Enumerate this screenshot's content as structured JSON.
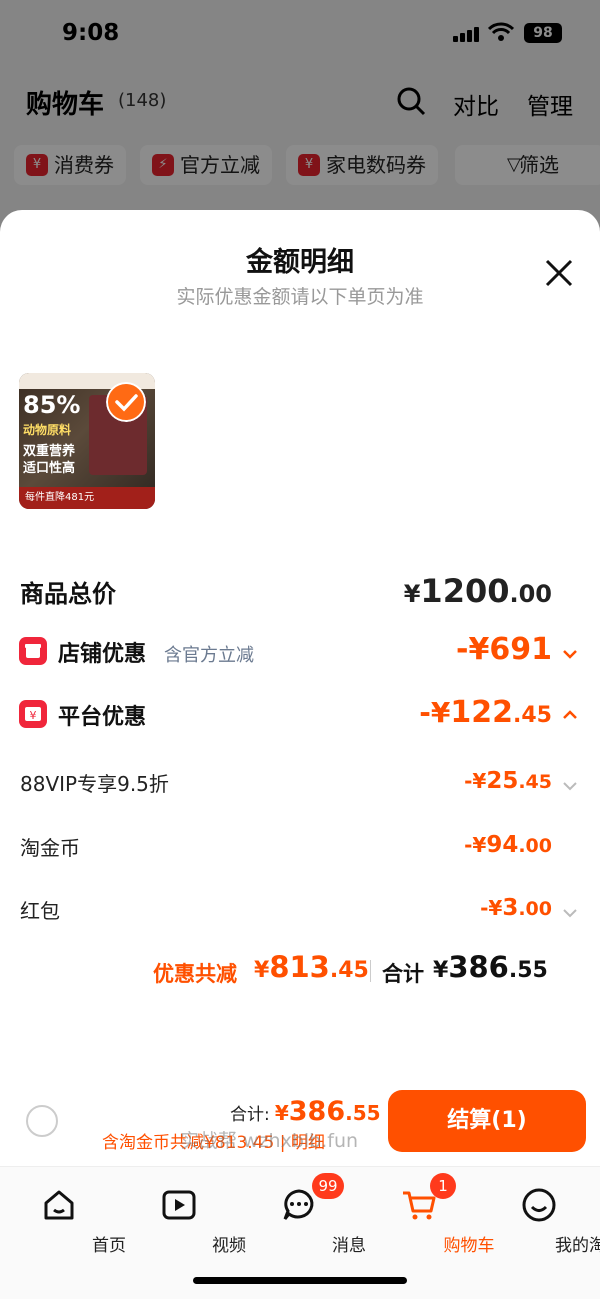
{
  "status": {
    "time": "9:08",
    "battery": "98"
  },
  "background_page": {
    "title": "购物车",
    "count": "(148)",
    "compare": "对比",
    "manage": "管理",
    "chips": [
      "消费券",
      "官方立减",
      "家电数码券",
      "筛选"
    ]
  },
  "sheet": {
    "title": "金额明细",
    "subtitle": "实际优惠金额请以下单页为准",
    "product_image": {
      "percent": "85%",
      "line1": "动物原料",
      "line2": "双重营养 适口性高",
      "bottom": "每件直降481元"
    },
    "rows": {
      "total": {
        "label": "商品总价",
        "yen": "¥",
        "int": "1200",
        "dec": ".00"
      },
      "store": {
        "label": "店铺优惠",
        "note": "含官方立减",
        "amount": "-¥691"
      },
      "platform": {
        "label": "平台优惠",
        "prefix": "-¥",
        "int": "122",
        "dec": ".45"
      },
      "vip": {
        "label": "88VIP专享9.5折",
        "prefix": "-¥",
        "int": "25",
        "dec": ".45"
      },
      "coins": {
        "label": "淘金币",
        "prefix": "-¥",
        "int": "94",
        "dec": ".00"
      },
      "redpacket": {
        "label": "红包",
        "prefix": "-¥",
        "int": "3",
        "dec": ".00"
      }
    },
    "summary": {
      "discount_label": "优惠共减",
      "discount_yen": "¥",
      "discount_int": "813",
      "discount_dec": ".45",
      "total_label": "合计",
      "total_yen": "¥",
      "total_int": "386",
      "total_dec": ".55"
    }
  },
  "bottom_bar": {
    "total_label": "合计:",
    "total_yen": "¥",
    "total_int": "386",
    "total_dec": ".55",
    "detail_text": "含淘金币共减¥813.45 | 明细",
    "checkout_label": "结算(1)",
    "watermark": "实战帮 wzhxblb.fun"
  },
  "tabs": [
    {
      "label": "首页",
      "icon": "home-icon"
    },
    {
      "label": "视频",
      "icon": "video-icon"
    },
    {
      "label": "消息",
      "icon": "message-icon",
      "badge": "99"
    },
    {
      "label": "购物车",
      "icon": "cart-icon",
      "badge": "1",
      "active": true
    },
    {
      "label": "我的淘宝",
      "icon": "profile-icon"
    }
  ],
  "colors": {
    "accent": "#ff5000",
    "badge": "#ff3a1c",
    "red_icon": "#f0263b"
  }
}
